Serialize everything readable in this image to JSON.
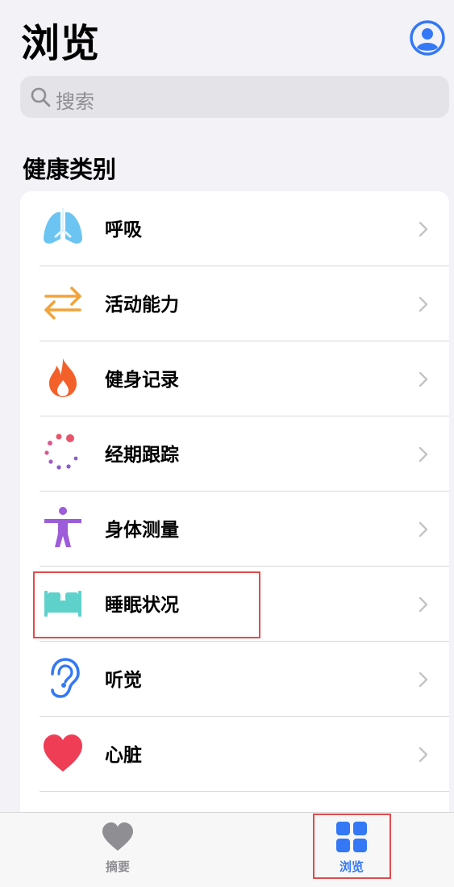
{
  "header": {
    "title": "浏览"
  },
  "search": {
    "placeholder": "搜索"
  },
  "section": {
    "title": "健康类别"
  },
  "categories": [
    {
      "label": "呼吸",
      "icon": "lungs-icon"
    },
    {
      "label": "活动能力",
      "icon": "arrows-icon"
    },
    {
      "label": "健身记录",
      "icon": "flame-icon"
    },
    {
      "label": "经期跟踪",
      "icon": "cycle-icon"
    },
    {
      "label": "身体测量",
      "icon": "figure-icon"
    },
    {
      "label": "睡眠状况",
      "icon": "bed-icon"
    },
    {
      "label": "听觉",
      "icon": "ear-icon"
    },
    {
      "label": "心脏",
      "icon": "heart-icon"
    }
  ],
  "tabbar": {
    "summary": {
      "label": "摘要",
      "icon": "heart-icon"
    },
    "browse": {
      "label": "浏览",
      "icon": "grid-icon"
    }
  },
  "colors": {
    "accent": "#3478f6",
    "tab_inactive": "#8e8e93",
    "highlight": "#e34b4b"
  }
}
